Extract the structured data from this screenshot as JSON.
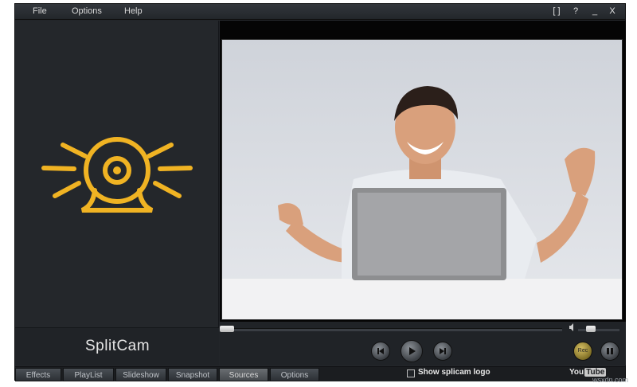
{
  "menu": [
    "File",
    "Options",
    "Help"
  ],
  "window_buttons": [
    "[ ]",
    "?",
    "_",
    "X"
  ],
  "brand": "SplitCam",
  "rec_label": "Rec",
  "tabs": [
    "Effects",
    "PlayList",
    "Slideshow",
    "Snapshot",
    "Sources",
    "Options"
  ],
  "active_tab": "Sources",
  "show_logo_label": "Show splicam logo",
  "youtube": {
    "you": "You",
    "tube": "Tube"
  },
  "watermark": "wsxdn.com",
  "colors": {
    "accent": "#f0b323",
    "bg": "#23262a"
  },
  "icons": [
    "webcam-logo-icon",
    "step-back-icon",
    "play-icon",
    "step-forward-icon",
    "pause-icon",
    "volume-icon"
  ],
  "seek_progress": 0,
  "volume_level": 0.25
}
